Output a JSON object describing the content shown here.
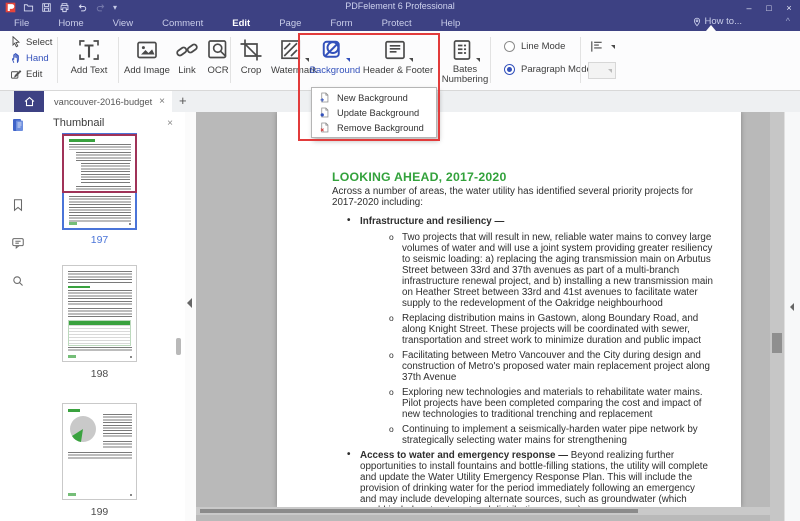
{
  "window": {
    "title": "PDFelement 6 Professional",
    "controls": {
      "minimize": "–",
      "maximize": "□",
      "close": "×"
    }
  },
  "icons": {
    "close": "×",
    "new_tab": "+",
    "chevron_up": "^",
    "quick_access": [
      "pdfelement-logo",
      "open-document-icon",
      "save-icon",
      "print-icon",
      "undo-icon",
      "redo-icon",
      "customize-caret-icon"
    ],
    "caret": "▾"
  },
  "menu": {
    "items": [
      "File",
      "Home",
      "View",
      "Comment",
      "Edit",
      "Page",
      "Form",
      "Protect",
      "Help"
    ],
    "active": "Edit",
    "how_to": "How to..."
  },
  "toolbar": {
    "select": "Select",
    "hand": "Hand",
    "edit": "Edit",
    "add_text": "Add Text",
    "add_image": "Add Image",
    "link": "Link",
    "ocr": "OCR",
    "crop": "Crop",
    "watermark": "Watermark",
    "background": "Background",
    "header_footer": "Header & Footer",
    "bates_line1": "Bates",
    "bates_line2": "Numbering",
    "line_mode": "Line Mode",
    "paragraph_mode": "Paragraph Mode",
    "paragraph_mode_selected": true
  },
  "background_menu": {
    "items": [
      {
        "icon": "page-plus-icon",
        "label": "New Background"
      },
      {
        "icon": "page-update-icon",
        "label": "Update Background"
      },
      {
        "icon": "page-remove-icon",
        "label": "Remove Background"
      }
    ]
  },
  "tabbar": {
    "active_tab": "vancouver-2016-budget"
  },
  "sidebar": {
    "panel_title": "Thumbnail",
    "icons": [
      "thumbnail-icon",
      "bookmark-icon",
      "comment-icon",
      "search-icon"
    ]
  },
  "thumbnails": {
    "pages": [
      {
        "number": "197",
        "selected": true
      },
      {
        "number": "198",
        "selected": false
      },
      {
        "number": "199",
        "selected": false
      }
    ]
  },
  "document": {
    "heading": "LOOKING AHEAD, 2017-2020",
    "intro": "Across a number of areas, the water utility has identified several priority projects for 2017-2020 including:",
    "bullet1_title": "Infrastructure and resiliency —",
    "sub_bullets": [
      "Two projects that will result in new, reliable water mains to convey large volumes of water and will use a joint system providing greater resiliency to seismic loading: a) replacing the aging transmission main on Arbutus Street between 33rd and 37th avenues as part of a multi-branch infrastructure renewal project, and b) installing a new transmission main on Heather Street between 33rd and 41st avenues to facilitate water supply to the redevelopment of the Oakridge neighbourhood",
      "Replacing distribution mains in Gastown, along Boundary Road, and along Knight Street. These projects will be coordinated with sewer, transportation and street work to minimize duration and public impact",
      "Facilitating between Metro Vancouver and the City during design and construction of Metro's proposed water main replacement project along 37th Avenue",
      "Exploring new technologies and materials to rehabilitate water mains. Pilot projects have been completed comparing the cost and impact of new technologies to traditional trenching and replacement",
      "Continuing to implement a seismically-harden water pipe network by strategically selecting water mains for strengthening"
    ],
    "bullet2_lead": "Access to water and emergency response —",
    "bullet2_text": " Beyond realizing further opportunities to install fountains and bottle-filling stations, the utility will complete and update the Water Utility Emergency Response Plan. This will include the provision of drinking water for the period immediately following an emergency and may include developing alternate sources, such as groundwater (which would include a treatment and distribution process)."
  },
  "colors": {
    "titlebar": "#3d4183",
    "accent_blue": "#3351bb",
    "heading_green": "#33a23c",
    "annotation_red": "#e23b3b",
    "selection_blue": "#4a74d8",
    "viewport_red": "#a03358"
  }
}
